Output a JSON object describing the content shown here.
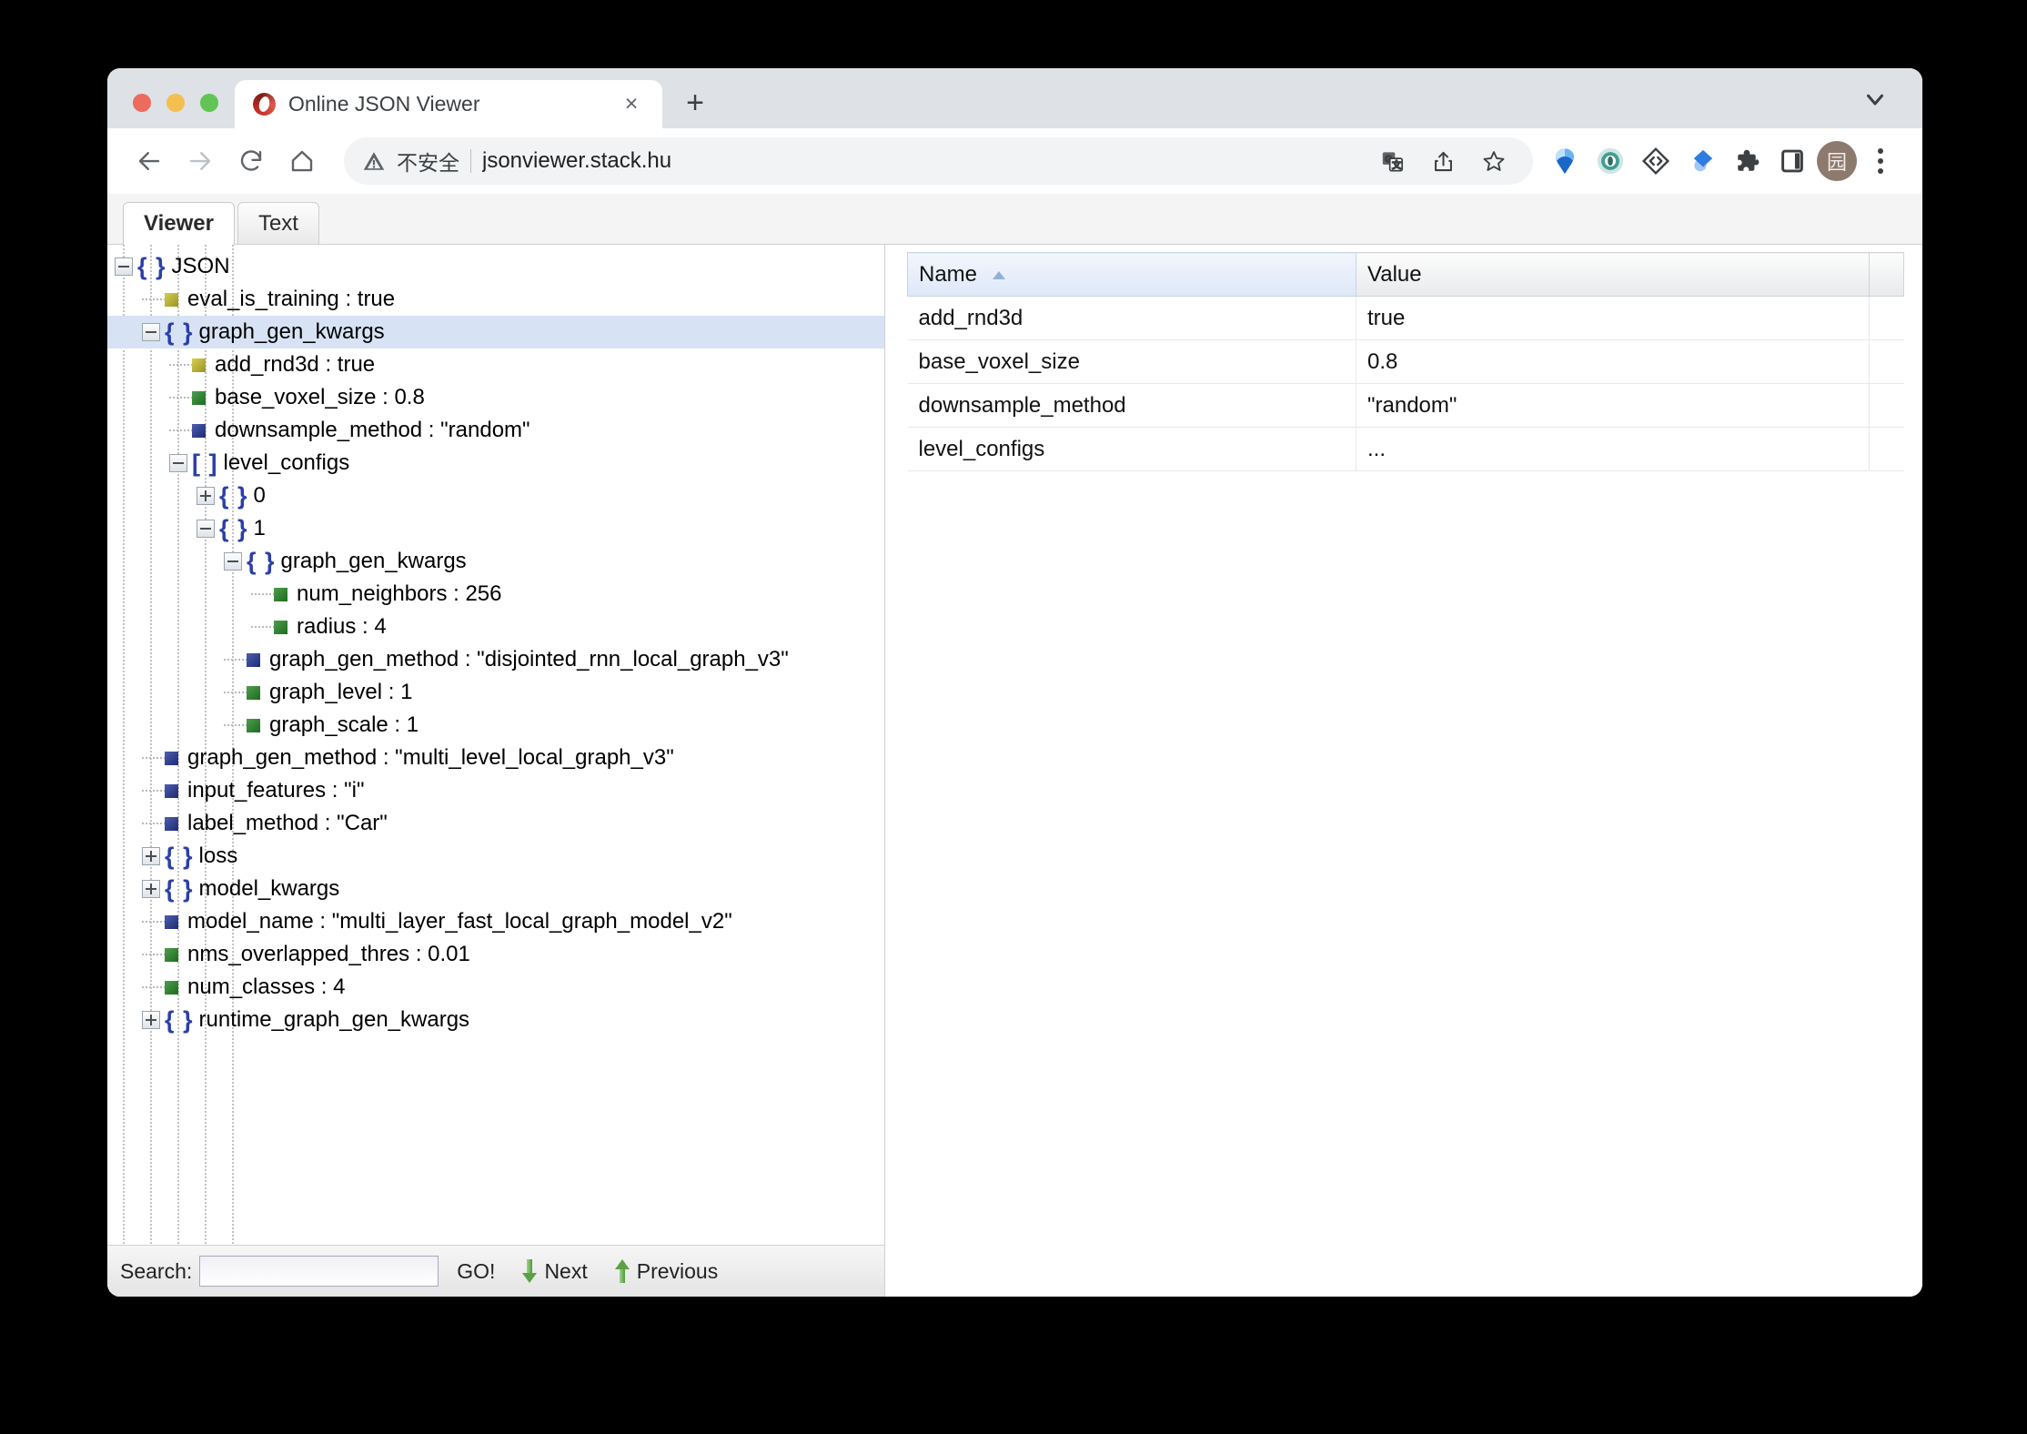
{
  "browser": {
    "tab": {
      "title": "Online JSON Viewer",
      "favicon": "json-viewer-favicon",
      "close_label": "×"
    },
    "new_tab_label": "+",
    "omnibox": {
      "security_icon": "not-secure-warning-icon",
      "security_text": "不安全",
      "url": "jsonviewer.stack.hu"
    },
    "toolbar_icons": [
      "back-icon",
      "forward-icon",
      "reload-icon",
      "home-icon",
      "translate-icon",
      "share-icon",
      "bookmark-star-icon",
      "ext-balloon-icon",
      "ext-eye-icon",
      "ext-code-diamond-icon",
      "ext-blue-drop-icon",
      "extensions-puzzle-icon",
      "side-panel-icon"
    ],
    "avatar_label": "园",
    "menu_label": "⋮"
  },
  "app": {
    "tabs": [
      {
        "label": "Viewer",
        "active": true
      },
      {
        "label": "Text",
        "active": false
      }
    ],
    "tree": [
      {
        "label": "JSON",
        "kind": "object",
        "depth": 0,
        "state": "expanded",
        "selected": false
      },
      {
        "label": "eval_is_training : true",
        "kind": "bool",
        "depth": 1,
        "state": "leaf",
        "selected": false
      },
      {
        "label": "graph_gen_kwargs",
        "kind": "object",
        "depth": 1,
        "state": "expanded",
        "selected": true
      },
      {
        "label": "add_rnd3d : true",
        "kind": "bool",
        "depth": 2,
        "state": "leaf",
        "selected": false
      },
      {
        "label": "base_voxel_size : 0.8",
        "kind": "number",
        "depth": 2,
        "state": "leaf",
        "selected": false
      },
      {
        "label": "downsample_method : \"random\"",
        "kind": "string",
        "depth": 2,
        "state": "leaf",
        "selected": false
      },
      {
        "label": "level_configs",
        "kind": "array",
        "depth": 2,
        "state": "expanded",
        "selected": false
      },
      {
        "label": "0",
        "kind": "object",
        "depth": 3,
        "state": "collapsed",
        "selected": false
      },
      {
        "label": "1",
        "kind": "object",
        "depth": 3,
        "state": "expanded",
        "selected": false
      },
      {
        "label": "graph_gen_kwargs",
        "kind": "object",
        "depth": 4,
        "state": "expanded",
        "selected": false
      },
      {
        "label": "num_neighbors : 256",
        "kind": "number",
        "depth": 5,
        "state": "leaf",
        "selected": false
      },
      {
        "label": "radius : 4",
        "kind": "number",
        "depth": 5,
        "state": "leaf",
        "selected": false
      },
      {
        "label": "graph_gen_method : \"disjointed_rnn_local_graph_v3\"",
        "kind": "string",
        "depth": 4,
        "state": "leaf",
        "selected": false
      },
      {
        "label": "graph_level : 1",
        "kind": "number",
        "depth": 4,
        "state": "leaf",
        "selected": false
      },
      {
        "label": "graph_scale : 1",
        "kind": "number",
        "depth": 4,
        "state": "leaf",
        "selected": false
      },
      {
        "label": "graph_gen_method : \"multi_level_local_graph_v3\"",
        "kind": "string",
        "depth": 1,
        "state": "leaf",
        "selected": false
      },
      {
        "label": "input_features : \"i\"",
        "kind": "string",
        "depth": 1,
        "state": "leaf",
        "selected": false
      },
      {
        "label": "label_method : \"Car\"",
        "kind": "string",
        "depth": 1,
        "state": "leaf",
        "selected": false
      },
      {
        "label": "loss",
        "kind": "object",
        "depth": 1,
        "state": "collapsed",
        "selected": false
      },
      {
        "label": "model_kwargs",
        "kind": "object",
        "depth": 1,
        "state": "collapsed",
        "selected": false
      },
      {
        "label": "model_name : \"multi_layer_fast_local_graph_model_v2\"",
        "kind": "string",
        "depth": 1,
        "state": "leaf",
        "selected": false
      },
      {
        "label": "nms_overlapped_thres : 0.01",
        "kind": "number",
        "depth": 1,
        "state": "leaf",
        "selected": false
      },
      {
        "label": "num_classes : 4",
        "kind": "number",
        "depth": 1,
        "state": "leaf",
        "selected": false
      },
      {
        "label": "runtime_graph_gen_kwargs",
        "kind": "object",
        "depth": 1,
        "state": "collapsed",
        "selected": false
      }
    ],
    "search": {
      "label": "Search:",
      "value": "",
      "placeholder": "",
      "go_label": "GO!",
      "next_label": "Next",
      "previous_label": "Previous"
    },
    "grid": {
      "columns": [
        {
          "label": "Name",
          "sorted": "asc"
        },
        {
          "label": "Value",
          "sorted": ""
        }
      ],
      "rows": [
        {
          "name": "add_rnd3d",
          "value": "true"
        },
        {
          "name": "base_voxel_size",
          "value": "0.8"
        },
        {
          "name": "downsample_method",
          "value": "\"random\""
        },
        {
          "name": "level_configs",
          "value": "..."
        }
      ]
    }
  },
  "colors": {
    "chrome_bg": "#dee1e6",
    "selection": "#d7e3f5",
    "brace_blue": "#2b3fa8",
    "chip_bool": "#b8b136",
    "chip_number": "#2f7f2f",
    "chip_string": "#2f3d8f",
    "sort_header": "#dde8f8"
  }
}
